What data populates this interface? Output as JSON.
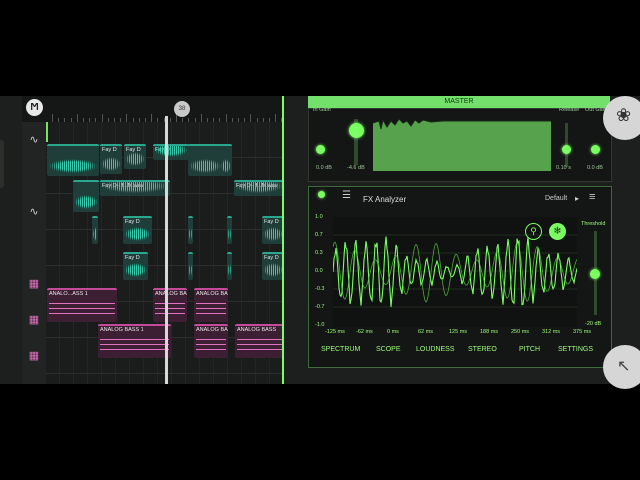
{
  "playhead_marker": "38",
  "tracks": {
    "clips": [
      {
        "label": "Fay D"
      },
      {
        "label": "Fay D"
      },
      {
        "label": "Fay D"
      },
      {
        "label": "Fay D - f...M.wav"
      },
      {
        "label": "Fay D - f...M.wav"
      },
      {
        "label": "Fay D"
      },
      {
        "label": "Fay D"
      },
      {
        "label": "Fay D"
      },
      {
        "label": "Fay D"
      },
      {
        "label": "ANALO...ASS 1"
      },
      {
        "label": "ANALOG BASS"
      },
      {
        "label": "ANALOG BASS"
      },
      {
        "label": "ANALOG BASS 1"
      },
      {
        "label": "ANALOG BASS"
      },
      {
        "label": "ANALOG BASS"
      }
    ]
  },
  "master": {
    "title": "MASTER",
    "in_gain_label": "In Gain",
    "in_gain_value": "0.0 dB",
    "threshold_value": "-4.6 dB",
    "release_label": "Release",
    "release_value": "0.10 s",
    "out_gain_label": "Out Gain",
    "out_gain_value": "0.0 dB"
  },
  "analyzer": {
    "title": "FX Analyzer",
    "preset": "Default",
    "threshold_label": "Threshold",
    "threshold_value": "-20 dB",
    "y_ticks": [
      "1.0",
      "0.7",
      "0.3",
      "0.0",
      "-0.3",
      "-0.7",
      "-1.0"
    ],
    "x_ticks": [
      "-125 ms",
      "-62 ms",
      "0 ms",
      "62 ms",
      "125 ms",
      "188 ms",
      "250 ms",
      "312 ms",
      "375 ms"
    ],
    "tabs": [
      "SPECTRUM",
      "SCOPE",
      "LOUDNESS",
      "STEREO",
      "PITCH",
      "SETTINGS"
    ]
  },
  "colors": {
    "accent": "#7aff62",
    "audio_clip": "#2aa88f",
    "midi_clip": "#c44b9a"
  }
}
